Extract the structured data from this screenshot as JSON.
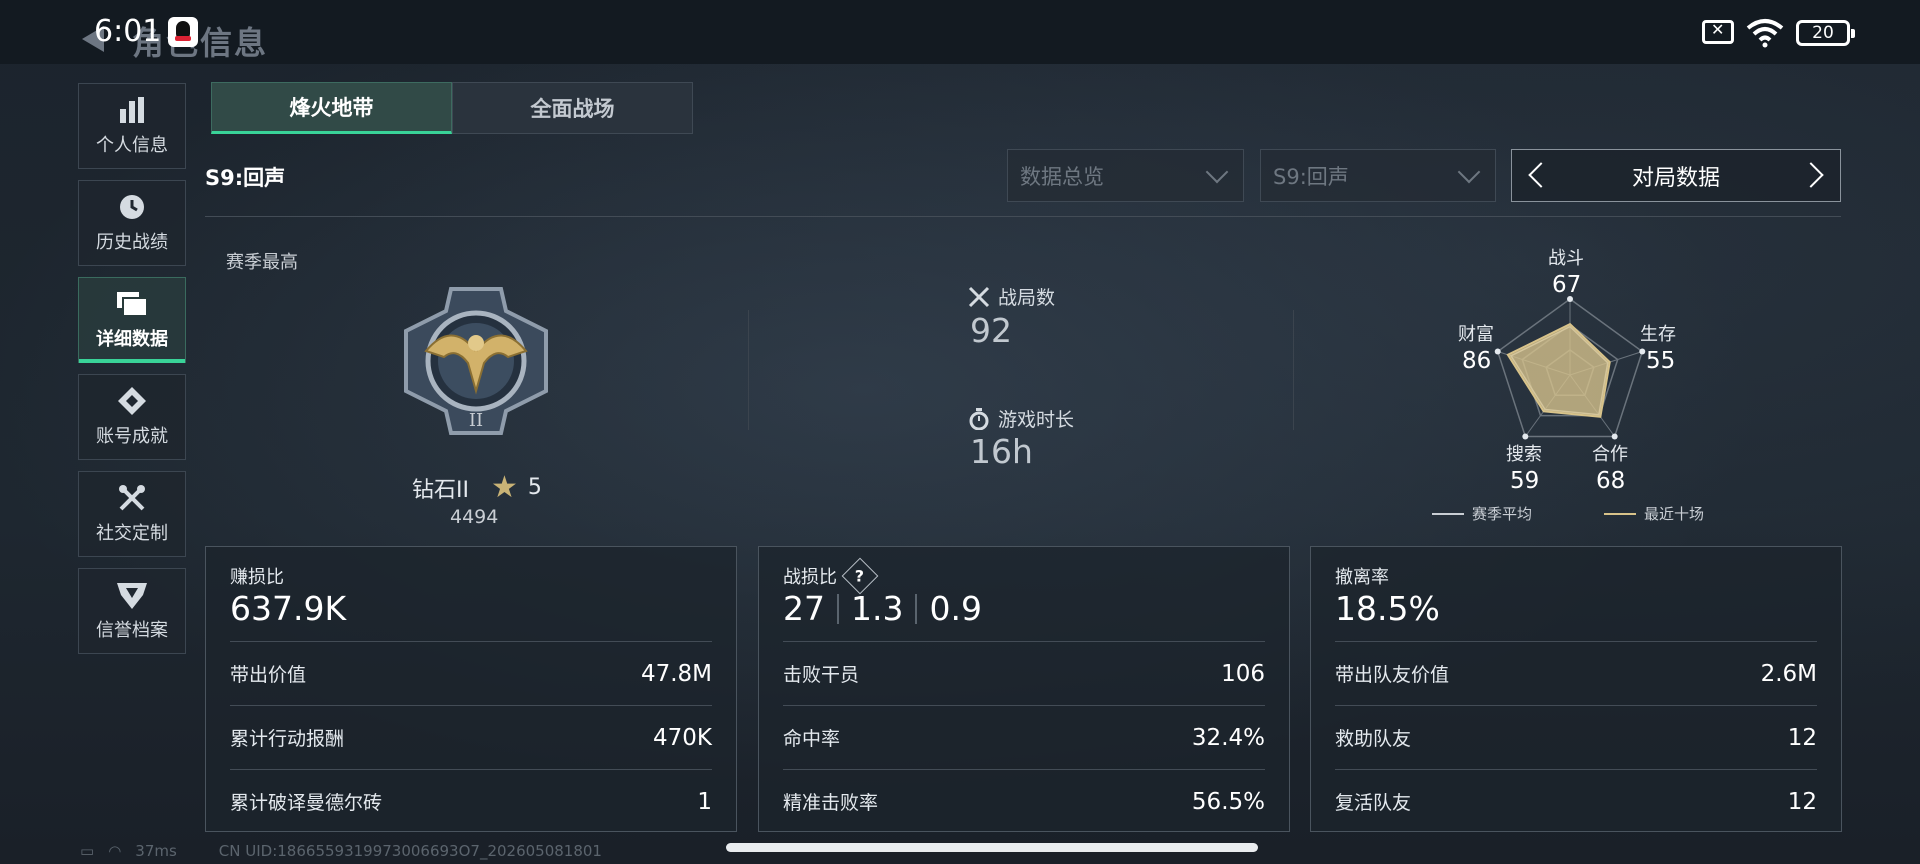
{
  "status_bar": {
    "time": "6:01",
    "battery": "20"
  },
  "header": {
    "title": "角色信息"
  },
  "sidebar": {
    "items": [
      {
        "label": "个人信息",
        "icon": "bar-chart-icon"
      },
      {
        "label": "历史战绩",
        "icon": "clock-icon"
      },
      {
        "label": "详细数据",
        "icon": "folder-icon",
        "active": true
      },
      {
        "label": "账号成就",
        "icon": "achievement-icon"
      },
      {
        "label": "社交定制",
        "icon": "tools-icon"
      },
      {
        "label": "信誉档案",
        "icon": "credit-icon"
      }
    ]
  },
  "tabs": [
    {
      "label": "烽火地带",
      "active": true
    },
    {
      "label": "全面战场",
      "active": false
    }
  ],
  "season": {
    "title": "S9:回声"
  },
  "filters": {
    "data_select": "数据总览",
    "season_select": "S9:回声",
    "switcher_label": "对局数据"
  },
  "season_best": {
    "label": "赛季最高",
    "rank": "钻石II",
    "stars": "5",
    "score": "4494"
  },
  "matches": {
    "label": "战局数",
    "value": "92"
  },
  "playtime": {
    "label": "游戏时长",
    "value": "16h"
  },
  "radar": {
    "axes": [
      {
        "label": "战斗",
        "value": "67"
      },
      {
        "label": "生存",
        "value": "55"
      },
      {
        "label": "合作",
        "value": "68"
      },
      {
        "label": "搜索",
        "value": "59"
      },
      {
        "label": "财富",
        "value": "86"
      }
    ],
    "legend": {
      "avg": "赛季平均",
      "recent": "最近十场"
    },
    "colors": {
      "avg": "#c9ced4",
      "recent": "#d8c38a"
    }
  },
  "cards": [
    {
      "title": "赚损比",
      "big": "637.9K",
      "rows": [
        {
          "label": "带出价值",
          "value": "47.8M"
        },
        {
          "label": "累计行动报酬",
          "value": "470K"
        },
        {
          "label": "累计破译曼德尔砖",
          "value": "1"
        }
      ]
    },
    {
      "title": "战损比",
      "help": "?",
      "big_parts": [
        "27",
        "1.3",
        "0.9"
      ],
      "rows": [
        {
          "label": "击败干员",
          "value": "106"
        },
        {
          "label": "命中率",
          "value": "32.4%"
        },
        {
          "label": "精准击败率",
          "value": "56.5%"
        }
      ]
    },
    {
      "title": "撤离率",
      "big": "18.5%",
      "rows": [
        {
          "label": "带出队友价值",
          "value": "2.6M"
        },
        {
          "label": "救助队友",
          "value": "12"
        },
        {
          "label": "复活队友",
          "value": "12"
        }
      ]
    }
  ],
  "footer": {
    "ping": "37ms",
    "uid": "CN UID:1866559319973006693O7_202605081801"
  }
}
